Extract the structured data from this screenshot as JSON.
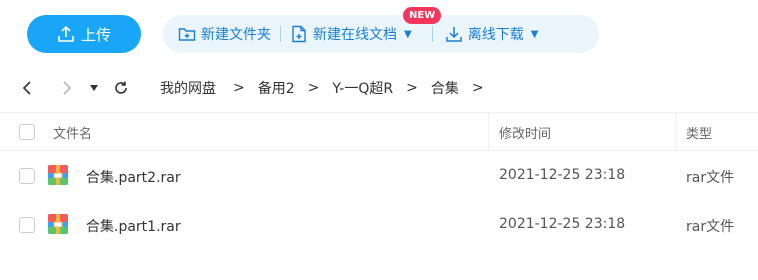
{
  "toolbar": {
    "upload_label": "上传",
    "new_folder_label": "新建文件夹",
    "new_online_doc_label": "新建在线文档",
    "offline_download_label": "离线下载",
    "new_badge": "NEW"
  },
  "breadcrumb": {
    "items": [
      "我的网盘",
      "备用2",
      "Y-一Q超R",
      "合集"
    ],
    "separator": ">"
  },
  "table": {
    "columns": [
      "文件名",
      "修改时间",
      "类型"
    ],
    "rows": [
      {
        "name": "合集.part2.rar",
        "modified": "2021-12-25 23:18",
        "type": "rar文件",
        "icon": "rar-archive-icon"
      },
      {
        "name": "合集.part1.rar",
        "modified": "2021-12-25 23:18",
        "type": "rar文件",
        "icon": "rar-archive-icon"
      }
    ]
  },
  "colors": {
    "accent": "#1aa6f7",
    "pill_bg": "#eaf5fe",
    "link_blue": "#1a7fd4",
    "badge_red": "#f5365c"
  }
}
